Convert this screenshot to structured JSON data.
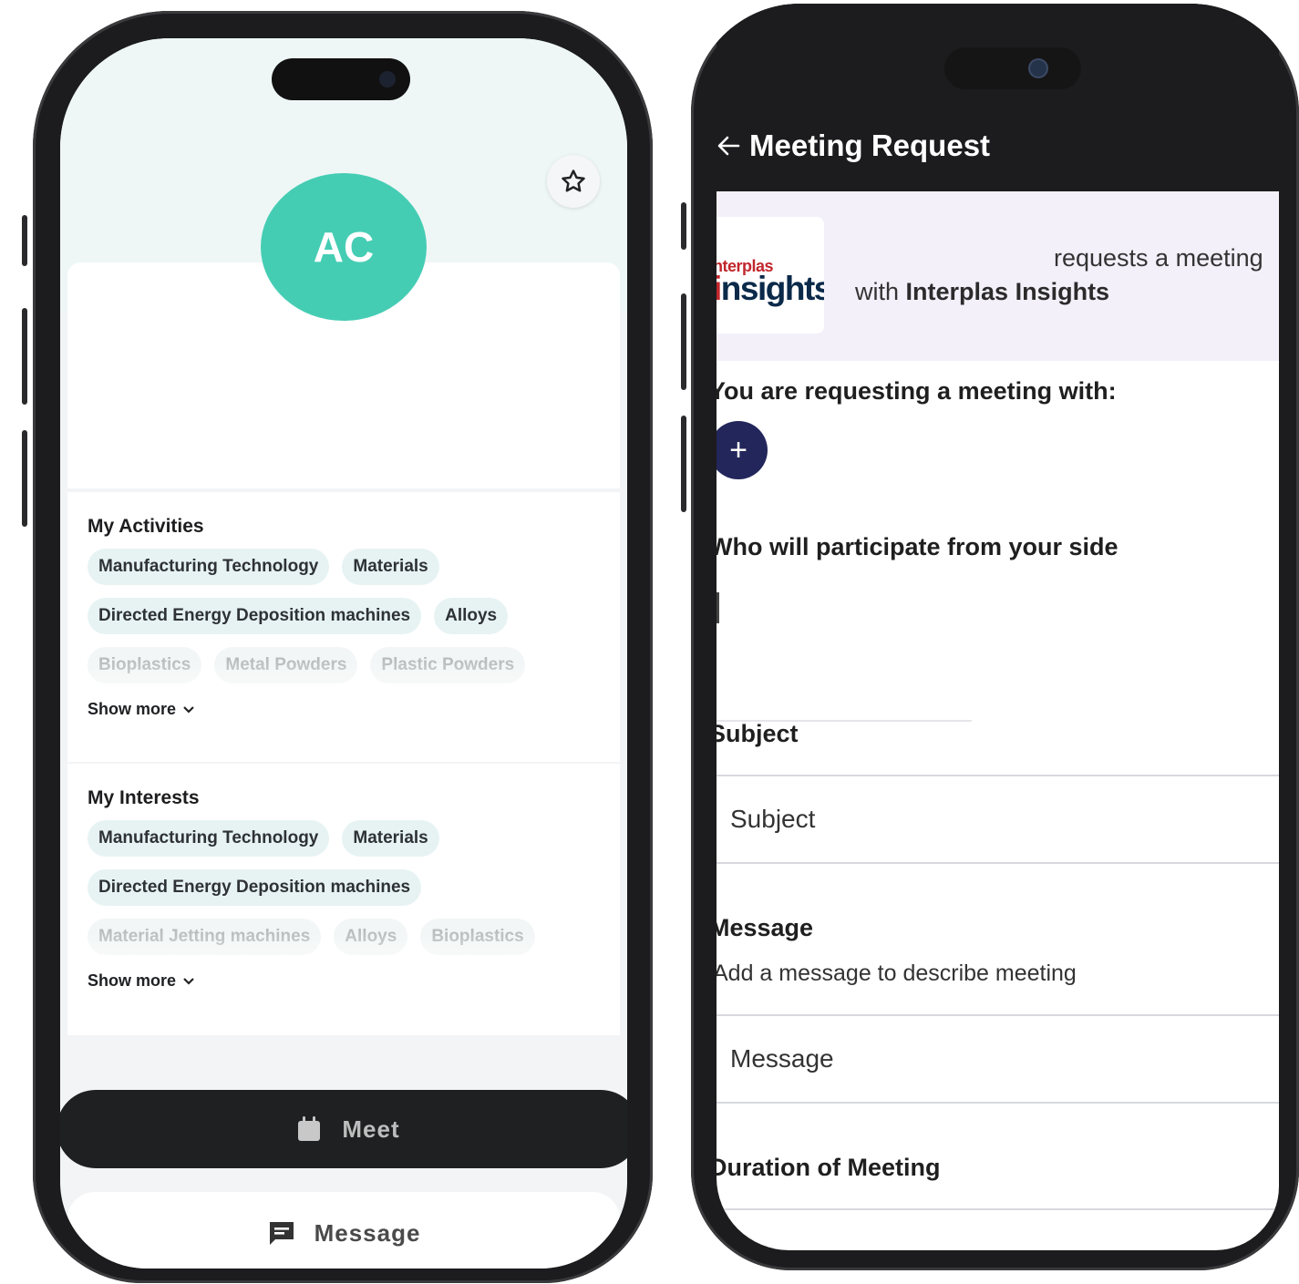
{
  "profile": {
    "initials": "AC",
    "activities": {
      "title": "My Activities",
      "chips": [
        [
          "Manufacturing Technology",
          "Materials"
        ],
        [
          "Directed Energy Deposition machines",
          "Alloys"
        ],
        [
          "Bioplastics",
          "Metal Powders",
          "Plastic Powders"
        ]
      ],
      "show_more": "Show more"
    },
    "interests": {
      "title": "My Interests",
      "chips": [
        [
          "Manufacturing Technology",
          "Materials"
        ],
        [
          "Directed Energy Deposition machines"
        ],
        [
          "Material Jetting machines",
          "Alloys",
          "Bioplastics"
        ]
      ],
      "show_more": "Show more"
    },
    "meet_label": "Meet",
    "message_label": "Message"
  },
  "meeting_request": {
    "title": "Meeting Request",
    "logo_top": "nterplas",
    "logo_main": "nsights",
    "logo_main_prefix": "i",
    "requests_text": "requests a meeting",
    "with_text": "with",
    "company": "Interplas Insights",
    "requesting_label": "You are requesting a meeting with:",
    "participate_label": "Who will participate from your side",
    "subject_label": "Subject",
    "subject_placeholder": "Subject",
    "message_label": "Message",
    "message_helper": "Add a message to describe meeting",
    "message_placeholder": "Message",
    "duration_label": "Duration of Meeting"
  }
}
